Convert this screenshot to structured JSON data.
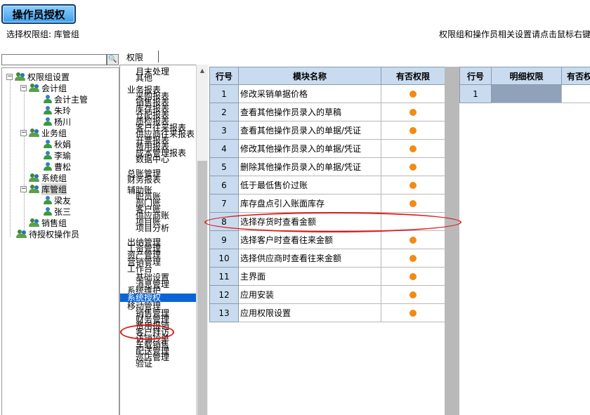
{
  "window": {
    "title": "操作员授权",
    "group_line": "选择权限组: 库管组",
    "hint": "权限组和操作员相关设置请点击鼠标右键"
  },
  "search": {
    "value": "",
    "button_icon": "magnifier-icon"
  },
  "tree": {
    "root": "权限组设置",
    "groups": [
      {
        "label": "会计组",
        "members": [
          "会计主管",
          "朱玲",
          "杨川"
        ]
      },
      {
        "label": "业务组",
        "members": [
          "秋娟",
          "李瑜",
          "曹松"
        ]
      },
      {
        "label": "系统组",
        "members": []
      },
      {
        "label": "库管组",
        "members": [
          "梁友",
          "张三"
        ]
      },
      {
        "label": "销售组",
        "members": []
      }
    ],
    "pending": "待授权操作员"
  },
  "tab": {
    "label": "权限"
  },
  "modules": [
    "月末处理",
    "其他",
    "业务报表",
    "采购报表",
    "销售报表",
    "库存报表",
    "仓配报表",
    "质检报表",
    "客户往来报表",
    "供应商往来报表",
    "开票报表",
    "费用报表",
    "成本管理报表",
    "数据中心",
    "总账管理",
    "财务报表",
    "辅助账",
    "职员账",
    "部门账",
    "客户账",
    "供应商账",
    "项目账",
    "项目分析",
    "出纳管理",
    "工资管理",
    "资产管理",
    "营销管理",
    "工作台",
    "基础设置",
    "消息管理",
    "系统维护",
    "系统授权",
    "移动管理",
    "销售管理",
    "财务管理",
    "费用报销",
    "客户拜访",
    "访销抄单",
    "车载销售",
    "配送管理",
    "巡店管理",
    "验证"
  ],
  "grid": {
    "headers": [
      "行号",
      "模块名称",
      "有否权限"
    ],
    "rows": [
      {
        "no": "1",
        "name": "修改采销单据价格",
        "has": true
      },
      {
        "no": "2",
        "name": "查看其他操作员录入的草稿",
        "has": true
      },
      {
        "no": "3",
        "name": "查看其他操作员录入的单据/凭证",
        "has": true
      },
      {
        "no": "4",
        "name": "修改其他操作员录入的单据/凭证",
        "has": true
      },
      {
        "no": "5",
        "name": "删除其他操作员录入的单据/凭证",
        "has": true
      },
      {
        "no": "6",
        "name": "低于最低售价过账",
        "has": true
      },
      {
        "no": "7",
        "name": "库存盘点引入账面库存",
        "has": true
      },
      {
        "no": "8",
        "name": "选择存货时查看金额",
        "has": false
      },
      {
        "no": "9",
        "name": "选择客户时查看往来金额",
        "has": true
      },
      {
        "no": "10",
        "name": "选择供应商时查看往来金额",
        "has": true
      },
      {
        "no": "11",
        "name": "主界面",
        "has": true
      },
      {
        "no": "12",
        "name": "应用安装",
        "has": true
      },
      {
        "no": "13",
        "name": "应用权限设置",
        "has": true
      }
    ]
  },
  "detail": {
    "headers": [
      "行号",
      "明细权限",
      "有否权"
    ],
    "rows": [
      {
        "no": "1"
      }
    ]
  },
  "colors": {
    "permission_dot": "#f28a14",
    "header_bg": "#c9dcef",
    "selection": "#0a64d8",
    "annotation": "#e01818"
  }
}
